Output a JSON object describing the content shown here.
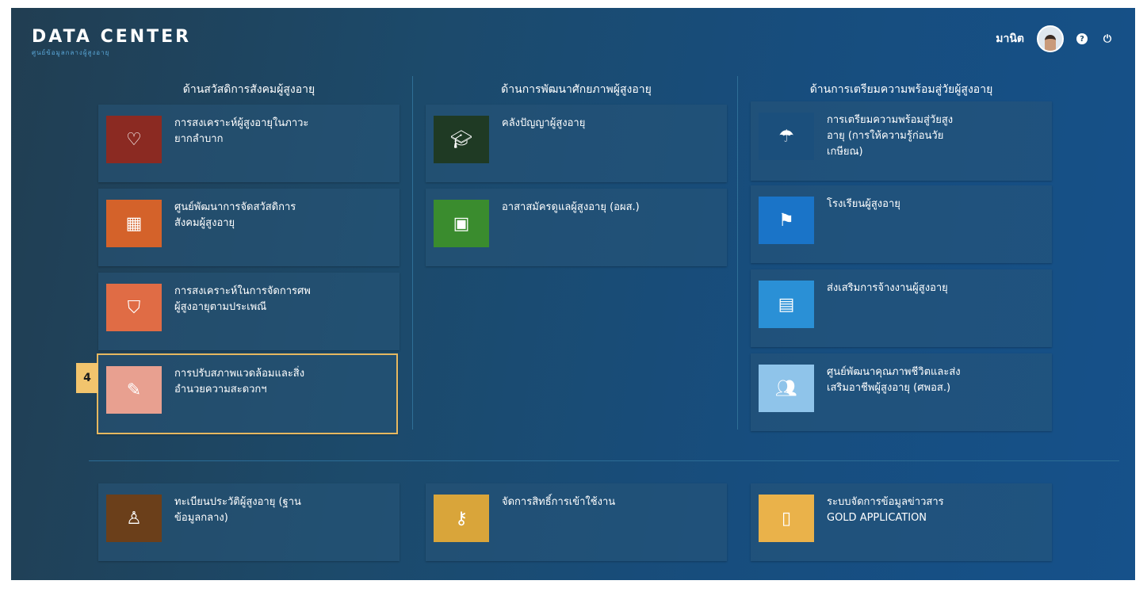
{
  "header": {
    "brand_title": "DATA CENTER",
    "brand_subtitle": "ศูนย์ข้อมูลกลางผู้สูงอายุ",
    "user_name": "มานิต",
    "help_icon": "question-circle-icon",
    "power_icon": "power-icon"
  },
  "columns": [
    {
      "title": "ด้านสวัสดิการสังคมผู้สูงอายุ"
    },
    {
      "title": "ด้านการพัฒนาศักยภาพผู้สูงอายุ"
    },
    {
      "title": "ด้านการเตรียมความพร้อมสู่วัยผู้สูงอายุ"
    }
  ],
  "tiles": [
    {
      "label": "การสงเคราะห์ผู้สูงอายุในภาวะ\nยากลำบาก",
      "icon": "heart-icon",
      "color": "#8b2a22"
    },
    {
      "label": "ศูนย์พัฒนาการจัดสวัสดิการ\nสังคมผู้สูงอายุ",
      "icon": "building-icon",
      "color": "#d4622a"
    },
    {
      "label": "การสงเคราะห์ในการจัดการศพ\nผู้สูงอายุตามประเพณี",
      "icon": "bookmark-icon",
      "color": "#e06c45"
    },
    {
      "label": "การปรับสภาพแวดล้อมและสิ่ง\nอำนวยความสะดวกฯ",
      "icon": "wrench-icon",
      "color": "#e8a090"
    },
    {
      "label": "คลังปัญญาผู้สูงอายุ",
      "icon": "graduation-cap-icon",
      "color": "#1f3a24"
    },
    {
      "label": "อาสาสมัครดูแลผู้สูงอายุ (อผส.)",
      "icon": "id-card-icon",
      "color": "#3a8c2e"
    },
    {
      "label": "การเตรียมความพร้อมสู่วัยสูง\nอายุ (การให้ความรู้ก่อนวัย\nเกษียณ)",
      "icon": "umbrella-icon",
      "color": "#1b4f7c"
    },
    {
      "label": "โรงเรียนผู้สูงอายุ",
      "icon": "flag-icon",
      "color": "#1a74c8"
    },
    {
      "label": "ส่งเสริมการจ้างงานผู้สูงอายุ",
      "icon": "briefcase-icon",
      "color": "#2a90d6"
    },
    {
      "label": "ศูนย์พัฒนาคุณภาพชีวิตและส่ง\nเสริมอาชีพผู้สูงอายุ (ศพอส.)",
      "icon": "people-icon",
      "color": "#8fc4ea"
    },
    {
      "label": "ทะเบียนประวัติผู้สูงอายุ (ฐาน\nข้อมูลกลาง)",
      "icon": "person-pin-icon",
      "color": "#6b3f1a"
    },
    {
      "label": "จัดการสิทธิ์การเข้าใช้งาน",
      "icon": "key-icon",
      "color": "#d9a53a"
    },
    {
      "label": "ระบบจัดการข้อมูลข่าวสาร\nGOLD APPLICATION",
      "icon": "mobile-icon",
      "color": "#eab24a"
    }
  ],
  "selected_badge": "4"
}
